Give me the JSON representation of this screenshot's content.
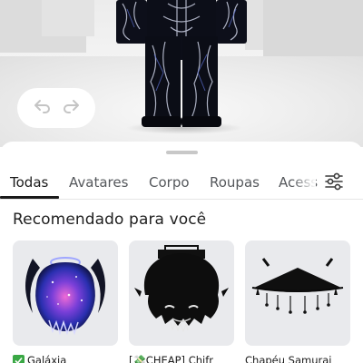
{
  "toolbar": {
    "undo_icon": "undo-arrow-icon",
    "redo_icon": "redo-arrow-icon"
  },
  "tabs": [
    {
      "label": "Todas",
      "active": true
    },
    {
      "label": "Avatares",
      "active": false
    },
    {
      "label": "Corpo",
      "active": false
    },
    {
      "label": "Roupas",
      "active": false
    },
    {
      "label": "Acess",
      "active": false
    }
  ],
  "filter_icon": "sliders-icon",
  "section": {
    "title": "Recomendado para você"
  },
  "items": [
    {
      "name": "Galáxia",
      "verified": true
    },
    {
      "name": "[💸CHEAP] Chifr",
      "verified": false
    },
    {
      "name": "Chapéu Samurai",
      "verified": false
    }
  ],
  "colors": {
    "accent_dark": "#1a1a1a",
    "muted_text": "#55585c",
    "thumb_bg": "#e9eaed",
    "verified_green": "#3aa845"
  }
}
